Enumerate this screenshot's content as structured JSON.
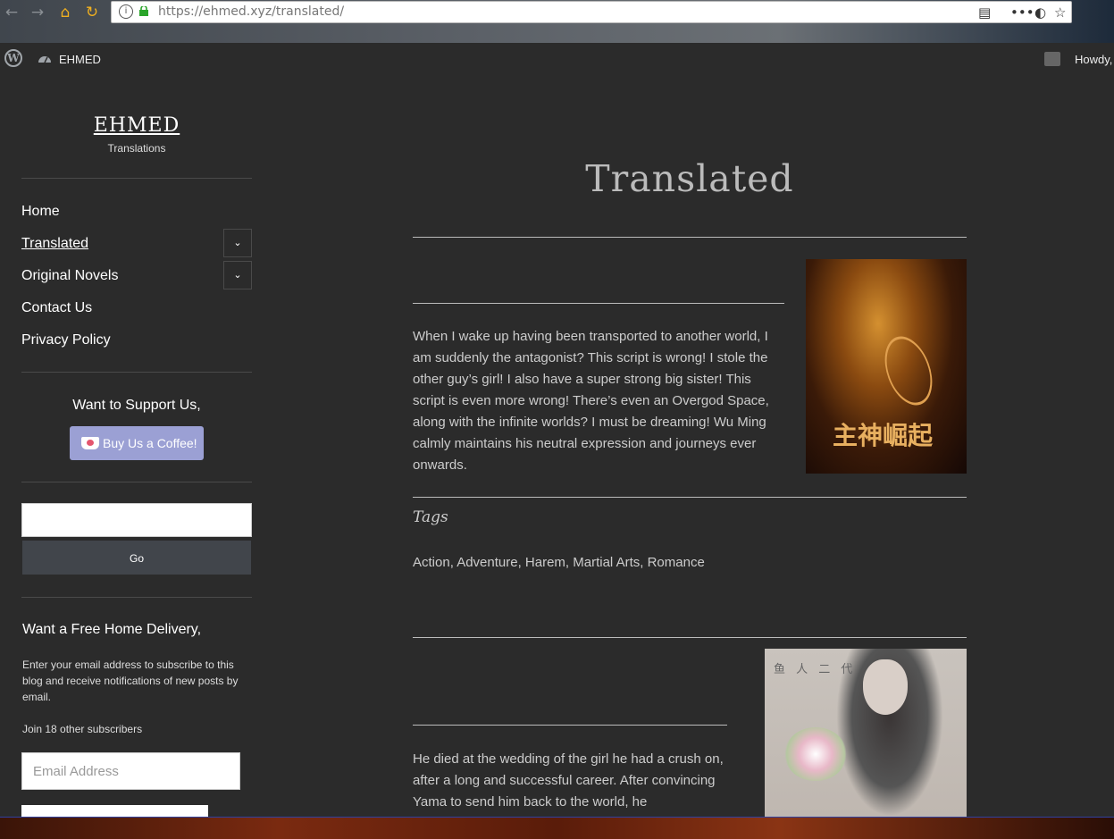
{
  "browser": {
    "back_icon": "back-arrow-icon",
    "forward_icon": "forward-arrow-icon",
    "home_icon": "home-icon",
    "reload_icon": "reload-icon",
    "url": "https://ehmed.xyz/translated/",
    "icons": [
      "reader-view-icon",
      "more-icon",
      "tracking-icon",
      "bookmark-star-icon"
    ]
  },
  "admin_bar": {
    "site_name": "EHMED",
    "howdy": "Howdy,"
  },
  "sidebar": {
    "site_title": "EHMED",
    "site_description": "Translations",
    "menu": [
      {
        "label": "Home"
      },
      {
        "label": "Translated"
      },
      {
        "label": "Original Novels"
      },
      {
        "label": "Contact Us"
      },
      {
        "label": "Privacy Policy"
      }
    ],
    "support_title": "Want to Support Us,",
    "coffee_label": "Buy Us a Coffee!",
    "search_button": "Go",
    "delivery_title": "Want a Free Home Delivery,",
    "subscribe_text": "Enter your email address to subscribe to this blog and receive notifications of new posts by email.",
    "subscribers": "Join 18 other subscribers",
    "email_placeholder": "Email Address"
  },
  "main": {
    "page_title": "Translated",
    "posts": [
      {
        "excerpt": "When I wake up having been transported to another world, I am suddenly the antagonist? This script is wrong! I stole the other guy’s girl! I also have a super strong big sister! This script is even more wrong! There’s even an Overgod Space, along with the infinite worlds? I must be dreaming! Wu Ming calmly maintains his neutral expression and journeys ever onwards.",
        "tags_heading": "Tags",
        "tags": "Action, Adventure, Harem, Martial Arts, Romance",
        "cover_text": "主神崛起"
      },
      {
        "excerpt": "He died at the wedding of the girl he had a crush on, after a long and successful career. After convincing Yama to send him back to the world, he",
        "cover_text": "鱼 人 二 代"
      }
    ]
  },
  "colors": {
    "background": "#2b2b2b",
    "coffee_button": "#9ba0d4",
    "go_button": "#41454b"
  }
}
